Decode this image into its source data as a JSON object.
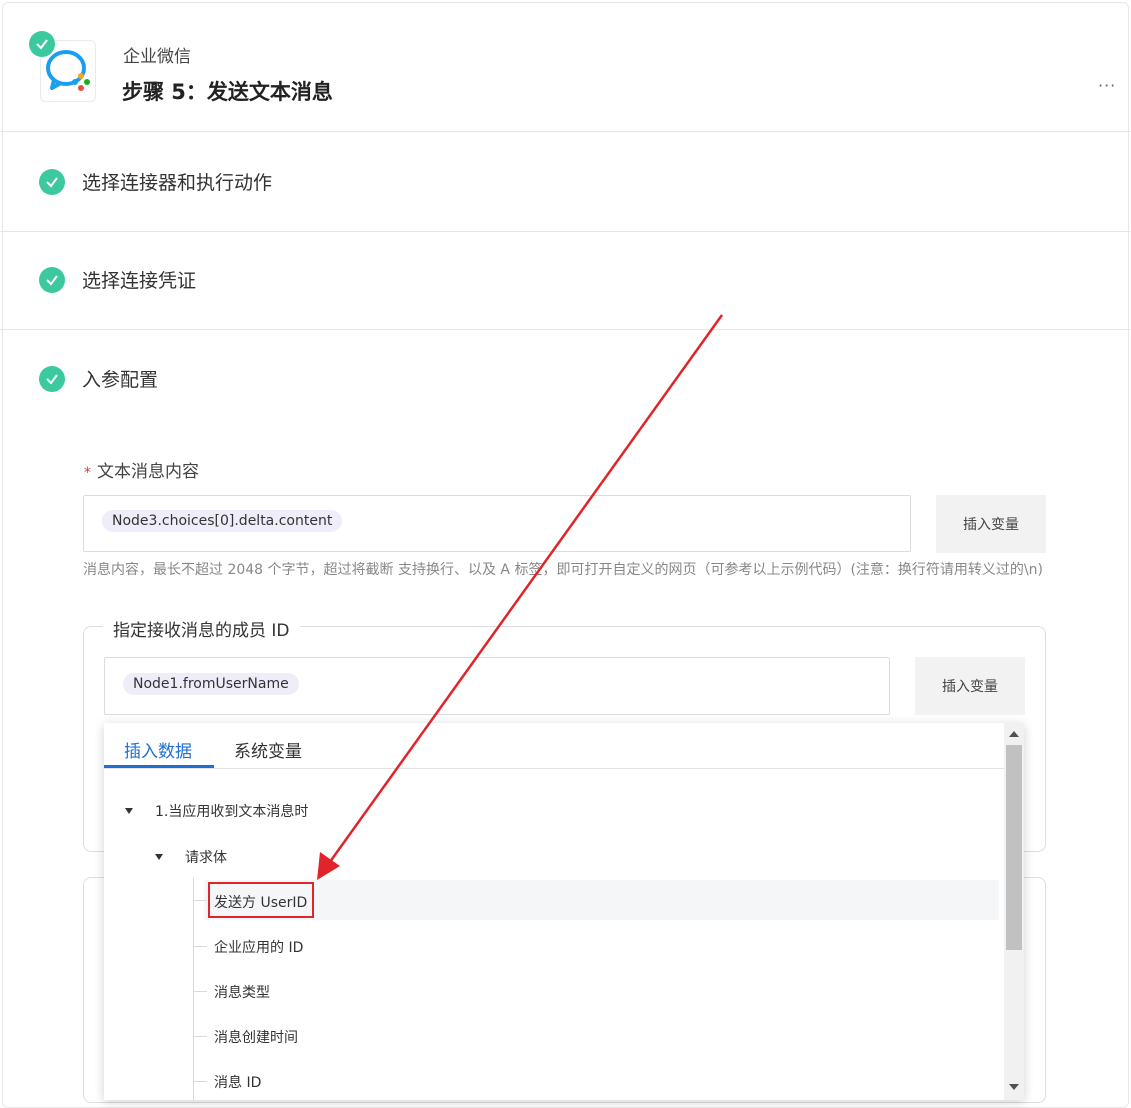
{
  "header": {
    "app_name": "企业微信",
    "step_title": "步骤 5：发送文本消息",
    "more": "···"
  },
  "sections": [
    {
      "title": "选择连接器和执行动作",
      "status": "done"
    },
    {
      "title": "选择连接凭证",
      "status": "done"
    },
    {
      "title": "入参配置",
      "status": "done"
    }
  ],
  "text_content_field": {
    "required_mark": "*",
    "label": "文本消息内容",
    "chip": "Node3.choices[0].delta.content",
    "insert_button": "插入变量",
    "hint": "消息内容，最长不超过 2048 个字节，超过将截断 支持换行、以及 A 标签，即可打开自定义的网页（可参考以上示例代码）(注意：换行符请用转义过的\\n)"
  },
  "member_id_field": {
    "legend": "指定接收消息的成员 ID",
    "chip": "Node1.fromUserName",
    "insert_button": "插入变量"
  },
  "dropdown": {
    "tabs": [
      {
        "label": "插入数据",
        "active": true
      },
      {
        "label": "系统变量",
        "active": false
      }
    ],
    "tree": {
      "node": "1.当应用收到文本消息时",
      "child": "请求体",
      "leaves": [
        "发送方 UserID",
        "企业应用的 ID",
        "消息类型",
        "消息创建时间",
        "消息 ID"
      ],
      "highlighted_leaf_index": 0
    }
  },
  "colors": {
    "accent": "#1f6fd1",
    "success": "#3cc9a0",
    "annotation": "#e0242a",
    "chip_bg": "#eeedf9"
  }
}
